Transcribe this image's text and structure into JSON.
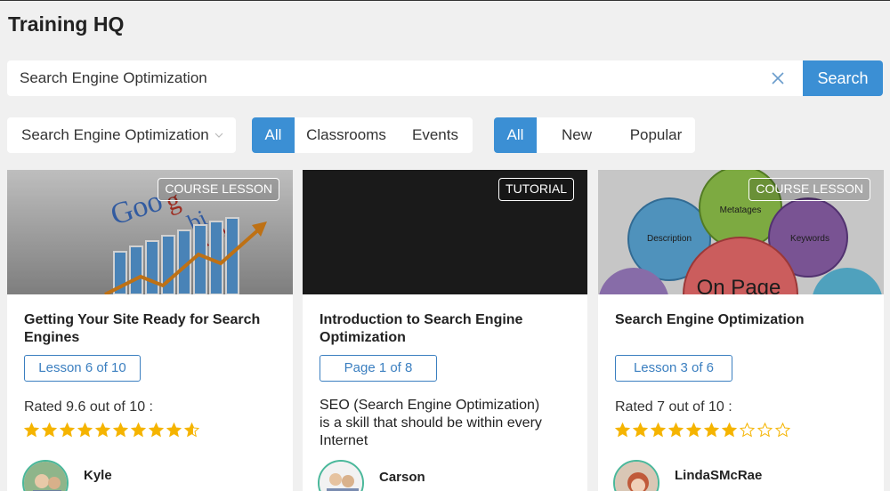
{
  "app": {
    "title": "Training HQ"
  },
  "search": {
    "value": "Search Engine Optimization",
    "button_label": "Search"
  },
  "filters": {
    "topic": "Search Engine Optimization",
    "scope_tabs": [
      "All",
      "Classrooms",
      "Events"
    ],
    "scope_active": "All",
    "sort_tabs": [
      "All",
      "New",
      "Popular"
    ],
    "sort_active": "All",
    "accent_color": "#3b8fd4"
  },
  "cards": [
    {
      "badge": "COURSE LESSON",
      "title": "Getting Your Site Ready for Search Engines",
      "progress": "Lesson 6 of 10",
      "rating_text": "Rated 9.6 out of 10 :",
      "rating": 9.6,
      "author": "Kyle"
    },
    {
      "badge": "TUTORIAL",
      "title": "Introduction to Search Engine Optimization",
      "progress": "Page 1 of 8",
      "description": "SEO (Search Engine Optimization) is a skill that should be within every Internet",
      "author": "Carson"
    },
    {
      "badge": "COURSE LESSON",
      "title": "Search Engine Optimization",
      "progress": "Lesson 3 of 6",
      "rating_text": "Rated 7 out of 10 :",
      "rating": 7,
      "author": "LindaSMcRae",
      "thumb_labels": [
        "Metatages",
        "Description",
        "Keywords",
        "On Page"
      ]
    }
  ]
}
